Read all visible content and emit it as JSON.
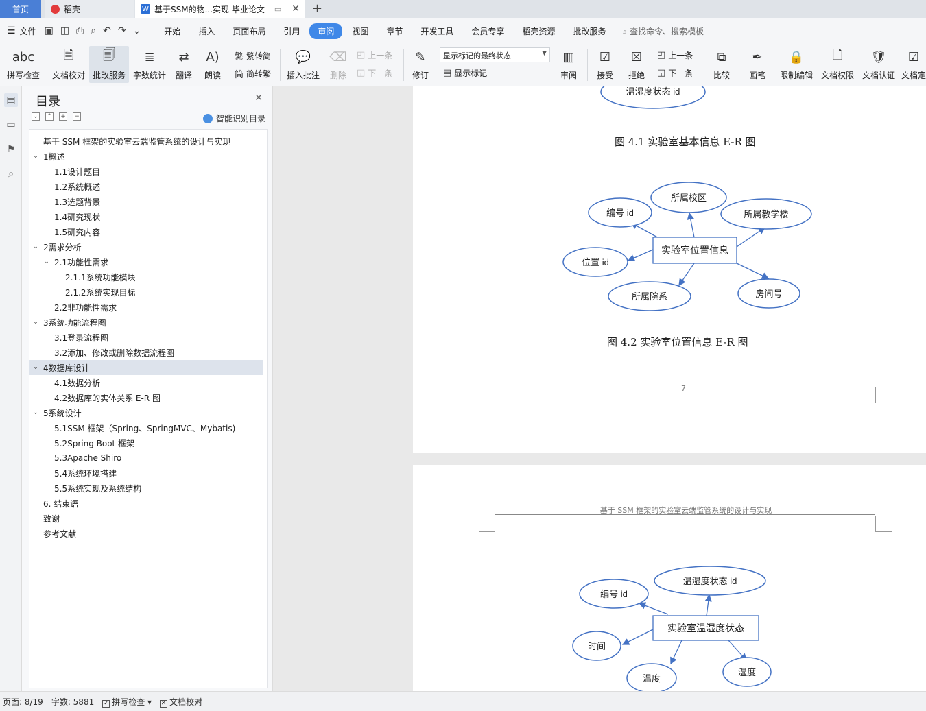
{
  "tabs": {
    "home": "首页",
    "daoke": "稻壳",
    "doc": "基于SSM的物...实现 毕业论文"
  },
  "menu": {
    "file": "文件",
    "items": [
      "开始",
      "插入",
      "页面布局",
      "引用",
      "审阅",
      "视图",
      "章节",
      "开发工具",
      "会员专享",
      "稻壳资源",
      "批改服务"
    ],
    "active": "审阅",
    "search": "查找命令、搜索模板"
  },
  "ribbon": {
    "spell": "拼写检查",
    "doc_check": "文档校对",
    "correct_service": "批改服务",
    "word_count": "字数统计",
    "translate": "翻译",
    "read_aloud": "朗读",
    "to_trad": "繁转简",
    "to_simp": "简转繁",
    "insert_comment": "插入批注",
    "delete": "删除",
    "prev": "上一条",
    "next": "下一条",
    "revise": "修订",
    "display_state": "显示标记的最终状态",
    "show_marks": "显示标记",
    "review": "审阅",
    "accept": "接受",
    "reject": "拒绝",
    "prev2": "上一条",
    "next2": "下一条",
    "compare": "比较",
    "pen": "画笔",
    "restrict": "限制编辑",
    "doc_rights": "文档权限",
    "doc_cert": "文档认证",
    "doc_final": "文档定"
  },
  "toc": {
    "title": "目录",
    "smart": "智能识别目录",
    "items": [
      {
        "label": "基于 SSM 框架的实验室云端监管系统的设计与实现",
        "level": 0,
        "arrow": ""
      },
      {
        "label": "1概述",
        "level": 0,
        "arrow": "v"
      },
      {
        "label": "1.1设计题目",
        "level": 1,
        "arrow": ""
      },
      {
        "label": "1.2系统概述",
        "level": 1,
        "arrow": ""
      },
      {
        "label": "1.3选题背景",
        "level": 1,
        "arrow": ""
      },
      {
        "label": "1.4研究现状",
        "level": 1,
        "arrow": ""
      },
      {
        "label": "1.5研究内容",
        "level": 1,
        "arrow": ""
      },
      {
        "label": "2需求分析",
        "level": 0,
        "arrow": "v"
      },
      {
        "label": "2.1功能性需求",
        "level": 1,
        "arrow": "v"
      },
      {
        "label": "2.1.1系统功能模块",
        "level": 2,
        "arrow": ""
      },
      {
        "label": "2.1.2系统实现目标",
        "level": 2,
        "arrow": ""
      },
      {
        "label": "2.2非功能性需求",
        "level": 1,
        "arrow": ""
      },
      {
        "label": "3系统功能流程图",
        "level": 0,
        "arrow": "v"
      },
      {
        "label": "3.1登录流程图",
        "level": 1,
        "arrow": ""
      },
      {
        "label": "3.2添加、修改或删除数据流程图",
        "level": 1,
        "arrow": ""
      },
      {
        "label": "4数据库设计",
        "level": 0,
        "arrow": "v",
        "active": true
      },
      {
        "label": "4.1数据分析",
        "level": 1,
        "arrow": ""
      },
      {
        "label": "4.2数据库的实体关系 E-R 图",
        "level": 1,
        "arrow": ""
      },
      {
        "label": "5系统设计",
        "level": 0,
        "arrow": "v"
      },
      {
        "label": "5.1SSM 框架（Spring、SpringMVC、Mybatis)",
        "level": 1,
        "arrow": ""
      },
      {
        "label": "5.2Spring Boot 框架",
        "level": 1,
        "arrow": ""
      },
      {
        "label": "5.3Apache Shiro",
        "level": 1,
        "arrow": ""
      },
      {
        "label": "5.4系统环境搭建",
        "level": 1,
        "arrow": ""
      },
      {
        "label": "5.5系统实现及系统结构",
        "level": 1,
        "arrow": ""
      },
      {
        "label": "6. 结束语",
        "level": 0,
        "arrow": ""
      },
      {
        "label": "致谢",
        "level": 0,
        "arrow": ""
      },
      {
        "label": "参考文献",
        "level": 0,
        "arrow": ""
      }
    ]
  },
  "doc": {
    "fig41_caption": "图 4.1 实验室基本信息 E-R 图",
    "fig41_partial_attr": "温湿度状态 id",
    "fig42_caption": "图 4.2 实验室位置信息 E-R 图",
    "fig42": {
      "entity": "实验室位置信息",
      "attrs": [
        "编号 id",
        "所属校区",
        "所属教学楼",
        "位置 id",
        "所属院系",
        "房间号"
      ]
    },
    "page_number": "7",
    "header": "基于 SSM 框架的实验室云端监管系统的设计与实现",
    "fig43": {
      "entity": "实验室温湿度状态",
      "attrs": [
        "编号 id",
        "温湿度状态 id",
        "时间",
        "温度",
        "湿度"
      ]
    }
  },
  "status": {
    "page": "页面: 8/19",
    "words": "字数: 5881",
    "spell": "拼写检查",
    "doc_check": "文档校对"
  }
}
